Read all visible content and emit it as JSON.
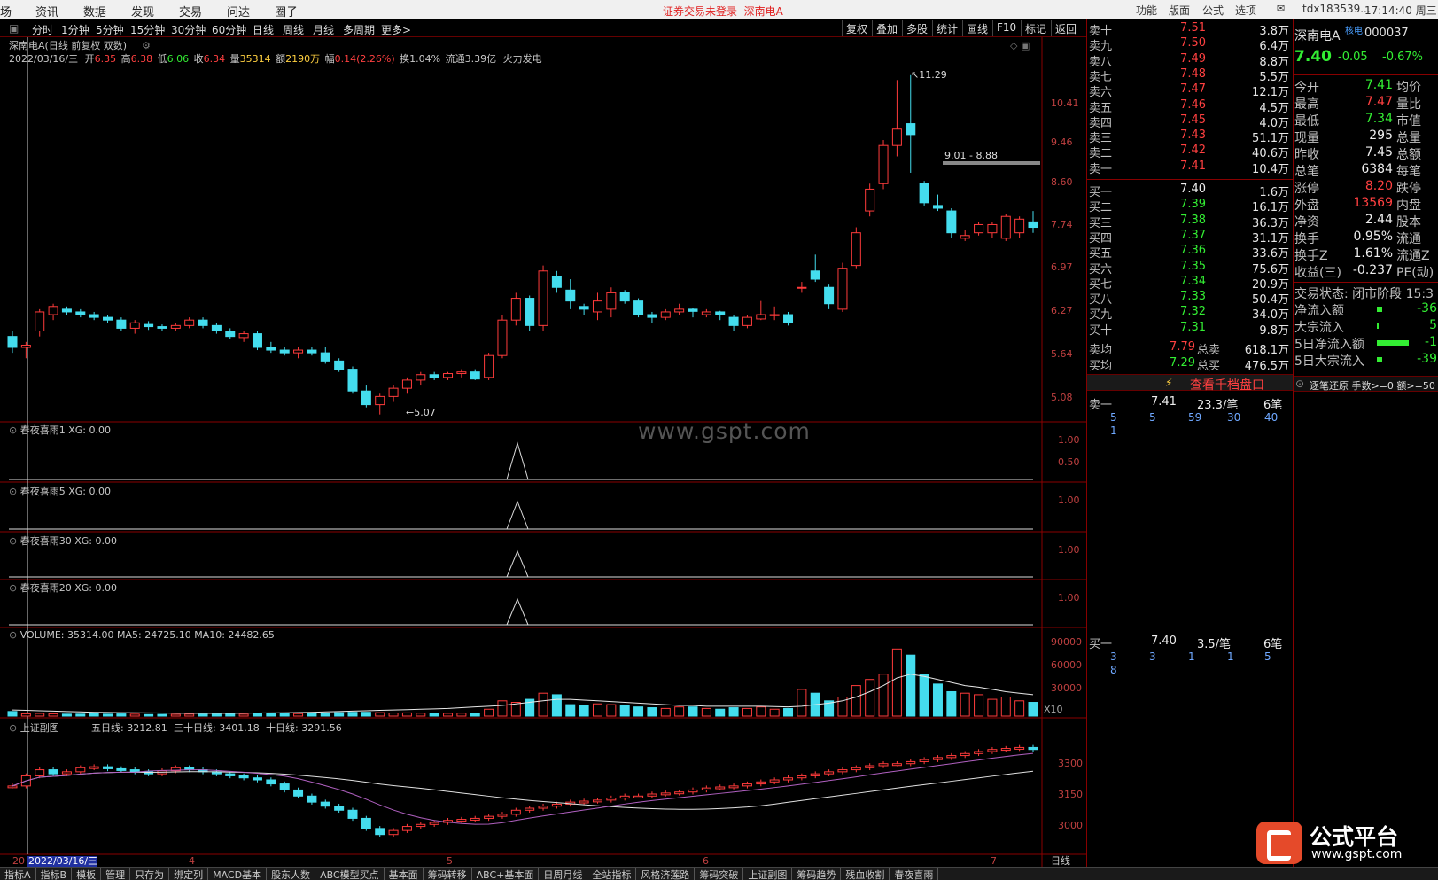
{
  "menu": {
    "items": [
      "场",
      "资讯",
      "数据",
      "发现",
      "交易",
      "问达",
      "圈子"
    ],
    "status": "证券交易未登录",
    "status_stock": "深南电A",
    "right": [
      "功能",
      "版面",
      "公式",
      "选项"
    ],
    "account": "tdx183539...",
    "time": "17:14:40 周三"
  },
  "toolbar": {
    "periods": [
      "分时",
      "1分钟",
      "5分钟",
      "15分钟",
      "30分钟",
      "60分钟",
      "日线",
      "周线",
      "月线",
      "多周期",
      "更多>"
    ],
    "right": [
      "复权",
      "叠加",
      "多股",
      "统计",
      "画线",
      "F10",
      "标记",
      "返回"
    ]
  },
  "main_header": {
    "title": "深南电A(日线 前复权 双数)",
    "date": "2022/03/16/三",
    "open_label": "开",
    "open": "6.35",
    "high_label": "高",
    "high": "6.38",
    "low_label": "低",
    "low": "6.06",
    "close_label": "收",
    "close": "6.34",
    "vol_label": "量",
    "vol": "35314",
    "amt_label": "额",
    "amt": "2190万",
    "chg_label": "幅",
    "chg": "0.14(2.26%)",
    "turn_label": "换",
    "turn": "1.04%",
    "float_label": "流通",
    "float": "3.39亿",
    "sector": "火力发电"
  },
  "price_axis": [
    "10.41",
    "9.46",
    "8.60",
    "7.74",
    "6.97",
    "6.27",
    "5.64",
    "5.08"
  ],
  "annotations": {
    "high": "11.29",
    "low": "5.07",
    "range": "9.01 - 8.88"
  },
  "indicators": [
    {
      "label": "春夜喜雨1",
      "xg": "XG: 0.00",
      "ticks": [
        "1.00",
        "0.50"
      ]
    },
    {
      "label": "春夜喜雨5",
      "xg": "XG: 0.00",
      "ticks": [
        "1.00"
      ]
    },
    {
      "label": "春夜喜雨30",
      "xg": "XG: 0.00",
      "ticks": [
        "1.00"
      ]
    },
    {
      "label": "春夜喜雨20",
      "xg": "XG: 0.00",
      "ticks": [
        "1.00"
      ]
    }
  ],
  "volume": {
    "label": "VOLUME: 35314.00",
    "ma5": "MA5: 24725.10",
    "ma10": "MA10: 24482.65",
    "ticks": [
      "90000",
      "60000",
      "30000"
    ],
    "unit": "X10"
  },
  "index_panel": {
    "label": "上证副图",
    "ma5": "五日线: 3212.81",
    "ma30": "三十日线: 3401.18",
    "ma10": "十日线: 3291.56",
    "ticks": [
      "3300",
      "3150",
      "3000"
    ]
  },
  "time_axis": {
    "start": "20",
    "cursor": "2022/03/16/三",
    "months": [
      "4",
      "5",
      "6",
      "7"
    ],
    "period_label": "日线"
  },
  "chart_data": {
    "type": "candlestick",
    "symbol": "深南电A",
    "ylim": [
      5.0,
      11.4
    ],
    "candles": [
      [
        6.5,
        6.6,
        6.2,
        6.3
      ],
      [
        6.3,
        6.4,
        6.1,
        6.34
      ],
      [
        6.6,
        7.0,
        6.5,
        6.95
      ],
      [
        6.9,
        7.1,
        6.8,
        7.05
      ],
      [
        7.0,
        7.05,
        6.9,
        6.95
      ],
      [
        6.95,
        7.0,
        6.85,
        6.9
      ],
      [
        6.9,
        6.95,
        6.8,
        6.85
      ],
      [
        6.85,
        6.9,
        6.75,
        6.8
      ],
      [
        6.8,
        6.85,
        6.6,
        6.65
      ],
      [
        6.65,
        6.8,
        6.55,
        6.75
      ],
      [
        6.72,
        6.78,
        6.62,
        6.68
      ],
      [
        6.68,
        6.72,
        6.6,
        6.65
      ],
      [
        6.65,
        6.75,
        6.6,
        6.7
      ],
      [
        6.7,
        6.85,
        6.65,
        6.8
      ],
      [
        6.8,
        6.85,
        6.65,
        6.7
      ],
      [
        6.7,
        6.75,
        6.55,
        6.6
      ],
      [
        6.6,
        6.65,
        6.45,
        6.5
      ],
      [
        6.48,
        6.6,
        6.4,
        6.55
      ],
      [
        6.55,
        6.6,
        6.25,
        6.3
      ],
      [
        6.3,
        6.4,
        6.2,
        6.25
      ],
      [
        6.25,
        6.3,
        6.15,
        6.2
      ],
      [
        6.2,
        6.3,
        6.1,
        6.25
      ],
      [
        6.25,
        6.3,
        6.15,
        6.2
      ],
      [
        6.2,
        6.3,
        6.0,
        6.05
      ],
      [
        6.05,
        6.1,
        5.85,
        5.9
      ],
      [
        5.9,
        5.95,
        5.45,
        5.5
      ],
      [
        5.5,
        5.6,
        5.2,
        5.25
      ],
      [
        5.25,
        5.45,
        5.07,
        5.4
      ],
      [
        5.4,
        5.6,
        5.3,
        5.55
      ],
      [
        5.55,
        5.75,
        5.45,
        5.7
      ],
      [
        5.7,
        5.85,
        5.6,
        5.8
      ],
      [
        5.8,
        5.85,
        5.7,
        5.75
      ],
      [
        5.75,
        5.85,
        5.7,
        5.82
      ],
      [
        5.82,
        5.9,
        5.75,
        5.85
      ],
      [
        5.85,
        5.9,
        5.7,
        5.72
      ],
      [
        5.75,
        6.2,
        5.7,
        6.15
      ],
      [
        6.15,
        6.9,
        6.1,
        6.8
      ],
      [
        6.8,
        7.3,
        6.7,
        7.2
      ],
      [
        7.2,
        7.25,
        6.6,
        6.7
      ],
      [
        6.7,
        7.8,
        6.6,
        7.7
      ],
      [
        7.6,
        7.7,
        7.3,
        7.4
      ],
      [
        7.35,
        7.55,
        7.0,
        7.15
      ],
      [
        7.05,
        7.1,
        6.9,
        7.0
      ],
      [
        6.95,
        7.3,
        6.8,
        7.15
      ],
      [
        7.0,
        7.4,
        6.85,
        7.3
      ],
      [
        7.3,
        7.35,
        7.1,
        7.15
      ],
      [
        7.15,
        7.2,
        6.85,
        6.9
      ],
      [
        6.9,
        6.95,
        6.75,
        6.85
      ],
      [
        6.85,
        7.0,
        6.8,
        6.95
      ],
      [
        6.95,
        7.1,
        6.9,
        7.0
      ],
      [
        7.0,
        7.02,
        6.85,
        6.96
      ],
      [
        6.9,
        7.0,
        6.85,
        6.95
      ],
      [
        6.95,
        6.97,
        6.8,
        6.9
      ],
      [
        6.85,
        6.9,
        6.6,
        6.7
      ],
      [
        6.7,
        6.9,
        6.65,
        6.85
      ],
      [
        6.82,
        7.15,
        6.8,
        6.9
      ],
      [
        6.88,
        7.05,
        6.8,
        6.9
      ],
      [
        6.9,
        6.95,
        6.7,
        6.75
      ],
      [
        7.4,
        7.5,
        7.3,
        7.4
      ],
      [
        7.7,
        8.0,
        7.5,
        7.55
      ],
      [
        7.4,
        7.45,
        7.0,
        7.1
      ],
      [
        7.0,
        7.85,
        6.95,
        7.75
      ],
      [
        7.8,
        8.5,
        7.75,
        8.4
      ],
      [
        8.8,
        9.3,
        8.7,
        9.2
      ],
      [
        9.3,
        10.1,
        9.2,
        10.0
      ],
      [
        10.0,
        11.2,
        9.8,
        10.3
      ],
      [
        10.4,
        11.29,
        9.5,
        10.2
      ],
      [
        9.3,
        9.35,
        8.9,
        8.95
      ],
      [
        8.9,
        9.1,
        8.8,
        8.85
      ],
      [
        8.8,
        8.85,
        8.3,
        8.4
      ],
      [
        8.3,
        8.45,
        8.25,
        8.35
      ],
      [
        8.4,
        8.6,
        8.35,
        8.55
      ],
      [
        8.4,
        8.6,
        8.3,
        8.55
      ],
      [
        8.3,
        8.75,
        8.25,
        8.7
      ],
      [
        8.4,
        8.7,
        8.3,
        8.65
      ],
      [
        8.6,
        8.8,
        8.4,
        8.5
      ]
    ],
    "volume_bars": [
      6000,
      3000,
      3500,
      3000,
      2500,
      2500,
      3000,
      2500,
      2800,
      2500,
      2000,
      2200,
      2300,
      2500,
      2400,
      2600,
      2800,
      2500,
      3500,
      3000,
      3500,
      3200,
      3000,
      3500,
      4500,
      5000,
      5000,
      4500,
      4000,
      4200,
      3800,
      3500,
      3600,
      3800,
      4000,
      9000,
      20000,
      18000,
      22000,
      30000,
      28000,
      15000,
      14000,
      16000,
      15000,
      14000,
      12000,
      11000,
      10000,
      12000,
      12000,
      10000,
      9000,
      11000,
      10000,
      12000,
      9000,
      10000,
      35000,
      30000,
      20000,
      25000,
      40000,
      48000,
      55000,
      88000,
      80000,
      55000,
      42000,
      32000,
      30000,
      28000,
      22000,
      25000,
      20000,
      18000
    ],
    "volume_ma": [
      8000,
      7500,
      7000,
      6500,
      6000,
      5500,
      5000,
      4800,
      4500,
      4300,
      4200,
      4000,
      3800,
      3700,
      3600,
      3600,
      3700,
      3800,
      4000,
      4200,
      4400,
      4600,
      5000,
      5500,
      6000,
      6500,
      7000,
      7500,
      8000,
      8500,
      9000,
      9500,
      10000,
      11000,
      12000,
      13000,
      14000,
      16000,
      18000,
      20000,
      22000,
      22000,
      21000,
      20000,
      19000,
      18000,
      17000,
      16000,
      15000,
      14000,
      14000,
      13000,
      13000,
      13000,
      13000,
      13000,
      12500,
      12000,
      13000,
      15000,
      17000,
      20000,
      25000,
      32000,
      40000,
      50000,
      55000,
      52000,
      48000,
      44000,
      40000,
      38000,
      35000,
      32000,
      30000,
      28000
    ],
    "index_close": [
      3200,
      3250,
      3280,
      3260,
      3270,
      3290,
      3295,
      3285,
      3280,
      3270,
      3260,
      3275,
      3290,
      3280,
      3270,
      3260,
      3250,
      3240,
      3230,
      3210,
      3180,
      3150,
      3120,
      3100,
      3080,
      3040,
      2990,
      2960,
      2980,
      3000,
      3010,
      3020,
      3030,
      3035,
      3040,
      3050,
      3060,
      3080,
      3090,
      3100,
      3110,
      3120,
      3125,
      3130,
      3140,
      3150,
      3150,
      3160,
      3165,
      3170,
      3180,
      3190,
      3195,
      3200,
      3210,
      3220,
      3230,
      3240,
      3250,
      3260,
      3270,
      3280,
      3290,
      3300,
      3310,
      3310,
      3320,
      3330,
      3340,
      3350,
      3360,
      3370,
      3380,
      3385,
      3390,
      3380
    ]
  },
  "depth": {
    "asks": [
      {
        "label": "卖十",
        "price": "7.51",
        "vol": "3.8万"
      },
      {
        "label": "卖九",
        "price": "7.50",
        "vol": "6.4万"
      },
      {
        "label": "卖八",
        "price": "7.49",
        "vol": "8.8万"
      },
      {
        "label": "卖七",
        "price": "7.48",
        "vol": "5.5万"
      },
      {
        "label": "卖六",
        "price": "7.47",
        "vol": "12.1万"
      },
      {
        "label": "卖五",
        "price": "7.46",
        "vol": "4.5万"
      },
      {
        "label": "卖四",
        "price": "7.45",
        "vol": "4.0万"
      },
      {
        "label": "卖三",
        "price": "7.43",
        "vol": "51.1万"
      },
      {
        "label": "卖二",
        "price": "7.42",
        "vol": "40.6万"
      },
      {
        "label": "卖一",
        "price": "7.41",
        "vol": "10.4万"
      }
    ],
    "bids": [
      {
        "label": "买一",
        "price": "7.40",
        "vol": "1.6万"
      },
      {
        "label": "买二",
        "price": "7.39",
        "vol": "16.1万"
      },
      {
        "label": "买三",
        "price": "7.38",
        "vol": "36.3万"
      },
      {
        "label": "买四",
        "price": "7.37",
        "vol": "31.1万"
      },
      {
        "label": "买五",
        "price": "7.36",
        "vol": "33.6万"
      },
      {
        "label": "买六",
        "price": "7.35",
        "vol": "75.6万"
      },
      {
        "label": "买七",
        "price": "7.34",
        "vol": "20.9万"
      },
      {
        "label": "买八",
        "price": "7.33",
        "vol": "50.4万"
      },
      {
        "label": "买九",
        "price": "7.32",
        "vol": "34.0万"
      },
      {
        "label": "买十",
        "price": "7.31",
        "vol": "9.8万"
      }
    ],
    "ask_avg": {
      "label": "卖均",
      "price": "7.79",
      "total_label": "总卖",
      "total": "618.1万"
    },
    "bid_avg": {
      "label": "买均",
      "price": "7.29",
      "total_label": "总买",
      "total": "476.5万"
    },
    "view_button": "查看千档盘口",
    "ask1_queue": {
      "label": "卖一",
      "price": "7.41",
      "per": "23.3/笔",
      "count": "6笔",
      "orders": [
        "5",
        "5",
        "59",
        "30",
        "40",
        "1"
      ]
    },
    "bid1_queue": {
      "label": "买一",
      "price": "7.40",
      "per": "3.5/笔",
      "count": "6笔",
      "orders": [
        "3",
        "3",
        "1",
        "1",
        "5",
        "8"
      ]
    }
  },
  "info": {
    "name": "深南电A",
    "tag": "核电",
    "code": "000037",
    "price": "7.40",
    "change": "-0.05",
    "pct": "-0.67%",
    "rows": [
      {
        "k": "今开",
        "v": "7.41",
        "c": "green",
        "k2": "均价"
      },
      {
        "k": "最高",
        "v": "7.47",
        "c": "red",
        "k2": "量比"
      },
      {
        "k": "最低",
        "v": "7.34",
        "c": "green",
        "k2": "市值"
      },
      {
        "k": "现量",
        "v": "295",
        "c": "white",
        "k2": "总量"
      },
      {
        "k": "昨收",
        "v": "7.45",
        "c": "white",
        "k2": "总额"
      },
      {
        "k": "总笔",
        "v": "6384",
        "c": "white",
        "k2": "每笔"
      },
      {
        "k": "涨停",
        "v": "8.20",
        "c": "red",
        "k2": "跌停"
      },
      {
        "k": "外盘",
        "v": "13569",
        "c": "red",
        "k2": "内盘"
      },
      {
        "k": "净资",
        "v": "2.44",
        "c": "white",
        "k2": "股本"
      },
      {
        "k": "换手",
        "v": "0.95%",
        "c": "white",
        "k2": "流通"
      },
      {
        "k": "换手Z",
        "v": "1.61%",
        "c": "white",
        "k2": "流通Z"
      },
      {
        "k": "收益(三)",
        "v": "-0.237",
        "c": "white",
        "k2": "PE(动)"
      }
    ],
    "state": "交易状态: 闭市阶段 15:3",
    "flows": [
      {
        "k": "净流入额",
        "v": "-36"
      },
      {
        "k": "大宗流入",
        "v": "5"
      },
      {
        "k": "5日净流入额",
        "v": "-1"
      },
      {
        "k": "5日大宗流入",
        "v": "-39"
      }
    ],
    "trade_header": "逐笔还原 手数>=0 额>=50"
  },
  "bottom_tabs": [
    "指标A",
    "指标B",
    "模板",
    "管理",
    "只存为",
    "绑定列",
    "MACD基本",
    "股东人数",
    "ABC模型买点",
    "基本面",
    "筹码转移",
    "ABC+基本面",
    "日周月线",
    "全站指标",
    "风格济莲路",
    "筹码突破",
    "上证副图",
    "筹码趋势",
    "残血收割",
    "春夜喜雨"
  ],
  "watermark": "www.gspt.com",
  "logo": {
    "title": "公式平台",
    "url": "www.gspt.com"
  }
}
